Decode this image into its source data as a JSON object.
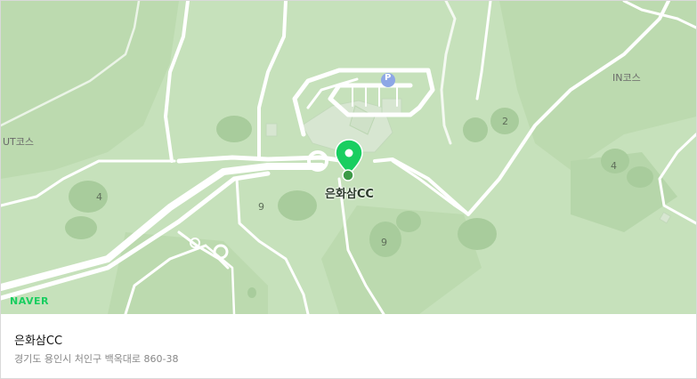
{
  "map": {
    "place_name": "은화삼CC",
    "course_labels": {
      "in": "IN코스",
      "out": "UT코스"
    },
    "hole_labels": [
      "2",
      "4",
      "4",
      "9",
      "9"
    ],
    "parking_symbol": "P",
    "provider": "NAVER",
    "colors": {
      "land": "#c6e1bb",
      "fairway": "#b1d3a5",
      "rough": "#a1c596",
      "road": "#ffffff",
      "building": "#d7e6d1",
      "pin": "#19ce60",
      "parking": "#8da7e6"
    }
  },
  "info": {
    "title": "은화삼CC",
    "address": "경기도 용인시 처인구 백옥대로 860-38"
  }
}
